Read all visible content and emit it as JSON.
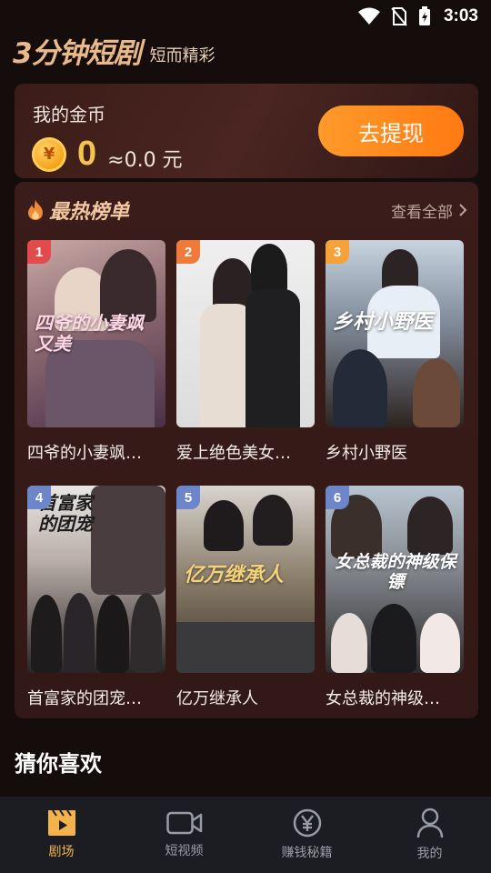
{
  "status": {
    "time": "3:03"
  },
  "header": {
    "brand": "3分钟短剧",
    "slogan": "短而精彩"
  },
  "coins": {
    "title": "我的金币",
    "currency_symbol": "¥",
    "value": "0",
    "approx": "≈0.0 元",
    "withdraw_label": "去提现"
  },
  "hot": {
    "title": "最热榜单",
    "see_all": "查看全部",
    "items": [
      {
        "rank": "1",
        "name": "四爷的小妻飒…",
        "poster_text": "四爷的小妻飒又美",
        "rank_color": "#e24b4b"
      },
      {
        "rank": "2",
        "name": "爱上绝色美女…",
        "poster_text": "",
        "rank_color": "#f07a3a"
      },
      {
        "rank": "3",
        "name": "乡村小野医",
        "poster_text": "乡村小野医",
        "rank_color": "#f5a23c"
      },
      {
        "rank": "4",
        "name": "首富家的团宠…",
        "poster_text": "首富家的团宠",
        "rank_color": "#6d86c9"
      },
      {
        "rank": "5",
        "name": "亿万继承人",
        "poster_text": "亿万继承人",
        "rank_color": "#6d86c9"
      },
      {
        "rank": "6",
        "name": "女总裁的神级…",
        "poster_text": "女总裁的神级保镖",
        "rank_color": "#6d86c9"
      }
    ]
  },
  "guess": {
    "title": "猜你喜欢"
  },
  "nav": {
    "items": [
      {
        "label": "剧场",
        "icon": "clapperboard-icon",
        "active": true
      },
      {
        "label": "短视频",
        "icon": "video-camera-icon",
        "active": false
      },
      {
        "label": "赚钱秘籍",
        "icon": "yuan-coin-icon",
        "active": false
      },
      {
        "label": "我的",
        "icon": "user-icon",
        "active": false
      }
    ]
  },
  "colors": {
    "accent": "#ff8a1e",
    "gold": "#f6c34d",
    "nav_active": "#f3b24a"
  }
}
